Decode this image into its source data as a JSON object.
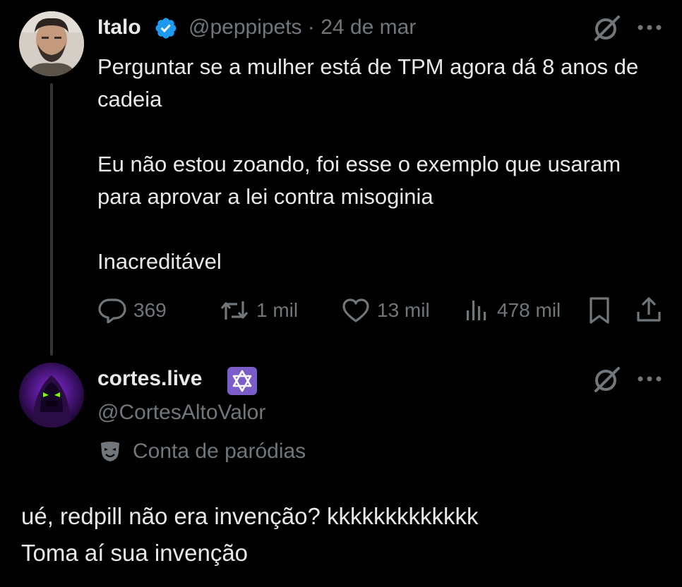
{
  "post": {
    "author": "Italo",
    "handle": "@peppipets",
    "separator": "·",
    "date": "24 de mar",
    "text_lines": [
      "Perguntar se a mulher está de TPM agora dá 8 anos de cadeia",
      "Eu não estou zoando, foi esse o exemplo que usaram para aprovar a lei contra misoginia",
      "Inacreditável"
    ],
    "metrics": {
      "replies": "369",
      "reposts": "1 mil",
      "likes": "13 mil",
      "views": "478 mil"
    }
  },
  "reply": {
    "author": "cortes.live",
    "handle": "@CortesAltoValor",
    "label": "Conta de paródias",
    "text_lines": [
      "ué, redpill não era invenção? kkkkkkkkkkkkk",
      "Toma aí sua invenção"
    ]
  },
  "colors": {
    "background": "#000000",
    "text": "#e7e9ea",
    "muted": "#71767b",
    "verified": "#1d9bf0",
    "badge_purple": "#7b5cc9"
  },
  "icons": [
    "grok-icon",
    "more-icon",
    "reply-icon",
    "repost-icon",
    "like-icon",
    "views-icon",
    "bookmark-icon",
    "share-icon",
    "verified-badge-icon",
    "star-of-david-icon",
    "mask-icon"
  ]
}
